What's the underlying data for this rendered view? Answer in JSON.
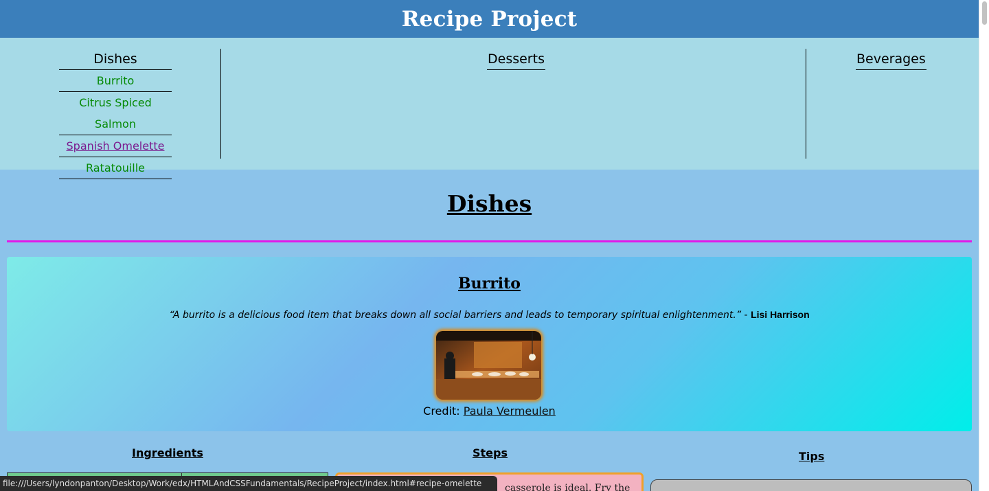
{
  "header": {
    "title": "Recipe Project"
  },
  "nav": {
    "dishes": {
      "title": "Dishes",
      "items": [
        {
          "label": "Burrito",
          "visited": false
        },
        {
          "label": "Citrus Spiced Salmon",
          "visited": false
        },
        {
          "label": "Spanish Omelette",
          "visited": true
        },
        {
          "label": "Ratatouille",
          "visited": false
        }
      ]
    },
    "desserts": {
      "title": "Desserts"
    },
    "beverages": {
      "title": "Beverages"
    }
  },
  "section": {
    "title": "Dishes"
  },
  "recipe": {
    "title": "Burrito",
    "quote": "“A burrito is a delicious food item that breaks down all social barriers and leads to temporary spiritual enlightenment.”",
    "quote_separator": " - ",
    "quote_author": "Lisi Harrison",
    "credit_label": "Credit:",
    "credit_name": "Paula Vermeulen"
  },
  "columns": {
    "ingredients": "Ingredients",
    "steps": "Steps",
    "tips": "Tips"
  },
  "steps_preview": "casserole is ideal. Fry the",
  "status_bar": {
    "url": "file:///Users/lyndonpanton/Desktop/Work/edx/HTMLAndCSSFundamentals/RecipeProject/index.html#recipe-omelette"
  },
  "colors": {
    "header_bg": "#3b7fbb",
    "nav_bg": "#a6dae7",
    "page_bg": "#8cc3ea",
    "link_green": "#068a06",
    "link_visited": "#7b1b8e",
    "divider_magenta": "#e21ae8"
  }
}
